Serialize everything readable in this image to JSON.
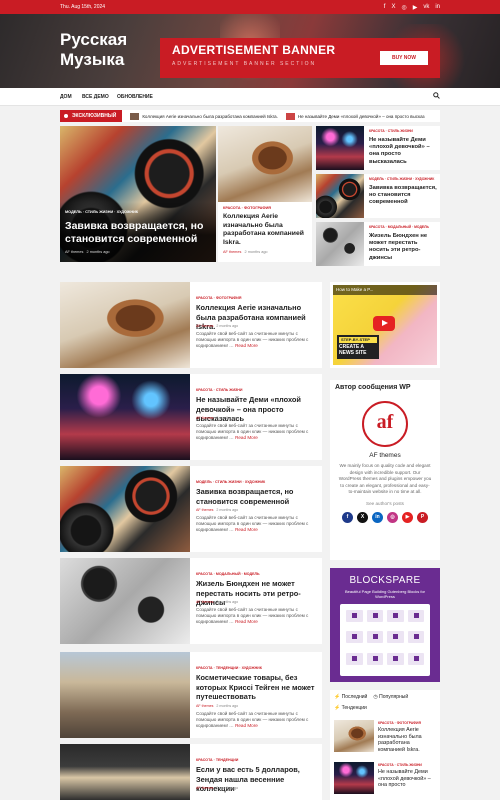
{
  "topbar": {
    "date": "Thu. Aug 15th, 2024",
    "social": [
      "f",
      "X",
      "◎",
      "▶",
      "vk",
      "in"
    ]
  },
  "site": {
    "title_line1": "Русская",
    "title_line2": "Музыка"
  },
  "ad": {
    "title": "ADVERTISEMENT BANNER",
    "subtitle": "ADVERTISEMENT BANNER SECTION",
    "button": "BUY NOW"
  },
  "nav": {
    "items": [
      "ДОМ",
      "ВСЕ ДЕМО",
      "ОБНОВЛЕНИЕ"
    ],
    "search_icon": "search-icon"
  },
  "ticker": {
    "badge": "ЭКСКЛЮЗИВНЫЙ",
    "items": [
      "Коллекция Aerie изначально была разработана компанией Iskra.",
      "Не называйте Деми «плохой девочкой» – она просто высказ"
    ]
  },
  "featured": {
    "big": {
      "cats": "МОДЕЛЬ  ·  СТИЛЬ ЖИЗНИ  ·  ХУДОЖНИК",
      "title": "Завивка возвращается, но становится современной",
      "author": "AF themes",
      "time": "2 months ago"
    },
    "mid": {
      "cats": "КРАСОТА  ·  ФОТОГРАФИЯ",
      "title": "Коллекция Aerie изначально была разработана компанией Iskra.",
      "author": "AF themes",
      "time": "2 months ago"
    },
    "side": [
      {
        "cats": "КРАСОТА  ·  СТИЛЬ ЖИЗНИ",
        "title": "Не называйте Деми «плохой девочкой» – она просто высказалась"
      },
      {
        "cats": "МОДЕЛЬ  ·  СТИЛЬ ЖИЗНИ  ·  ХУДОЖНИК",
        "title": "Завивка возвращается, но становится современной"
      },
      {
        "cats": "КРАСОТА  ·  МОДАЛЬНЫЙ  ·  МОДЕЛЬ",
        "title": "Жизель Бюндхен не может перестать носить эти ретро-джинсы"
      }
    ]
  },
  "posts": [
    {
      "cats": "КРАСОТА  ·  ФОТОГРАФИЯ",
      "title": "Коллекция Aerie изначально была разработана компанией Iskra.",
      "author": "AF themes",
      "time": "2 months ago",
      "excerpt": "Создайте свой веб-сайт за считанные минуты с помощью импорта в один клик — никаких проблем с кодированием! …",
      "more": "Read More"
    },
    {
      "cats": "КРАСОТА  ·  СТИЛЬ ЖИЗНИ",
      "title": "Не называйте Деми «плохой девочкой» – она просто высказалась",
      "author": "AF themes",
      "time": "2 months ago",
      "excerpt": "Создайте свой веб-сайт за считанные минуты с помощью импорта в один клик — никаких проблем с кодированием! …",
      "more": "Read More"
    },
    {
      "cats": "МОДЕЛЬ  ·  СТИЛЬ ЖИЗНИ  ·  ХУДОЖНИК",
      "title": "Завивка возвращается, но становится современной",
      "author": "AF themes",
      "time": "2 months ago",
      "excerpt": "Создайте свой веб-сайт за считанные минуты с помощью импорта в один клик — никаких проблем с кодированием! …",
      "more": "Read More"
    },
    {
      "cats": "КРАСОТА  ·  МОДАЛЬНЫЙ  ·  МОДЕЛЬ",
      "title": "Жизель Бюндхен не может перестать носить эти ретро-джинсы",
      "author": "AF themes",
      "time": "2 months ago",
      "excerpt": "Создайте свой веб-сайт за считанные минуты с помощью импорта в один клик — никаких проблем с кодированием! …",
      "more": "Read More"
    },
    {
      "cats": "КРАСОТА  ·  ТЕНДЕНЦИИ  ·  ХУДОЖНИК",
      "title": "Косметические товары, без которых Криссі Тейген не может путешествовать",
      "author": "AF themes",
      "time": "2 months ago",
      "excerpt": "Создайте свой веб-сайт за считанные минуты с помощью импорта в один клик — никаких проблем с кодированием! …",
      "more": "Read More"
    },
    {
      "cats": "КРАСОТА  ·  ТЕНДЕНЦИИ",
      "title": "Если у вас есть 5 долларов, Зендая нашла весенние коллекции",
      "author": "AF themes",
      "time": "2 months ago",
      "excerpt": "",
      "more": ""
    }
  ],
  "video": {
    "title": "How to Make a P...",
    "banner_tag": "STEP-BY-STEP",
    "banner_text": "CREATE A NEWS SITE"
  },
  "author_widget": {
    "heading": "Автор сообщения WP",
    "logo": "af",
    "name": "AF themes",
    "desc": "We mainly focus on quality code and elegant design with incredible support. Our WordPress themes and plugins empower you to create an elegant, professional and easy-to-maintain website in no time at all.",
    "posts_link": "See author's posts",
    "social": [
      "f",
      "X",
      "in",
      "◎",
      "▶",
      "P"
    ]
  },
  "blockspare": {
    "title": "BLOCKSPARE",
    "subtitle": "Beautiful Page Building Gutenberg Blocks for WordPress"
  },
  "tabs_widget": {
    "tab1": "Последний",
    "tab2": "Популярный",
    "tab3": "Тенденции",
    "items": [
      {
        "cats": "КРАСОТА  ·  ФОТОГРАФИЯ",
        "title": "Коллекция Aerie изначально была разработана компанией Iskra."
      },
      {
        "cats": "КРАСОТА  ·  СТИЛЬ ЖИЗНИ",
        "title": "Не называйте Деми «плохой девочкой» – она просто"
      }
    ]
  },
  "colors": {
    "accent": "#c91c24",
    "blockspare": "#6a2c91"
  }
}
